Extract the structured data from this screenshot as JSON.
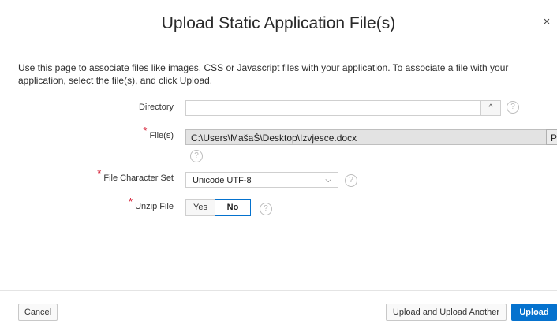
{
  "dialog": {
    "title": "Upload Static Application File(s)",
    "close_glyph": "×",
    "intro": "Use this page to associate files like images, CSS or Javascript files with your application. To associate a file with your application, select the file(s), and click Upload."
  },
  "form": {
    "directory": {
      "label": "Directory",
      "value": "",
      "button_glyph": "^",
      "help_glyph": "?"
    },
    "files": {
      "label": "File(s)",
      "required": "*",
      "value": "C:\\Users\\MašaŠ\\Desktop\\Izvjesce.docx",
      "browse_label": "Pregl",
      "help_glyph": "?"
    },
    "charset": {
      "label": "File Character Set",
      "required": "*",
      "value": "Unicode UTF-8",
      "chevron_glyph": "⌵",
      "help_glyph": "?"
    },
    "unzip": {
      "label": "Unzip File",
      "required": "*",
      "options": [
        "Yes",
        "No"
      ],
      "selected": "No",
      "help_glyph": "?"
    }
  },
  "footer": {
    "cancel_label": "Cancel",
    "upload_another_label": "Upload and Upload Another",
    "upload_label": "Upload"
  },
  "colors": {
    "accent": "#0572ce",
    "required": "#d0021b",
    "file_field_bg": "#e3e3e3"
  }
}
